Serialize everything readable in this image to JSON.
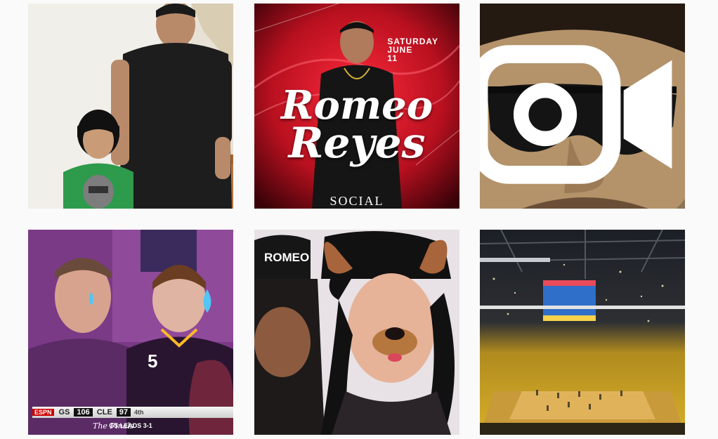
{
  "grid": {
    "posts": [
      {
        "type": "photo",
        "icon": ""
      },
      {
        "type": "photo",
        "poster": {
          "day": "SATURDAY",
          "month": "JUNE",
          "date": "11",
          "name_line1": "Romeo",
          "name_line2": "Reyes",
          "venue": "SOCIAL"
        }
      },
      {
        "type": "video",
        "icon": "video-icon"
      },
      {
        "type": "photo",
        "shirt_number": "5",
        "scoreboard": {
          "network": "ESPN",
          "team1": "GS",
          "score1": "106",
          "team2": "CLE",
          "score2": "97",
          "quarter": "4th",
          "series": "GS LEADS 3-1",
          "event": "The Finals"
        }
      },
      {
        "type": "photo",
        "cap_text": "ROMEO"
      },
      {
        "type": "photo"
      }
    ]
  },
  "colors": {
    "background": "#fafafa",
    "poster_red": "#c8102e",
    "cavs_wine": "#6f263d",
    "warriors_gold": "#fdb927"
  }
}
